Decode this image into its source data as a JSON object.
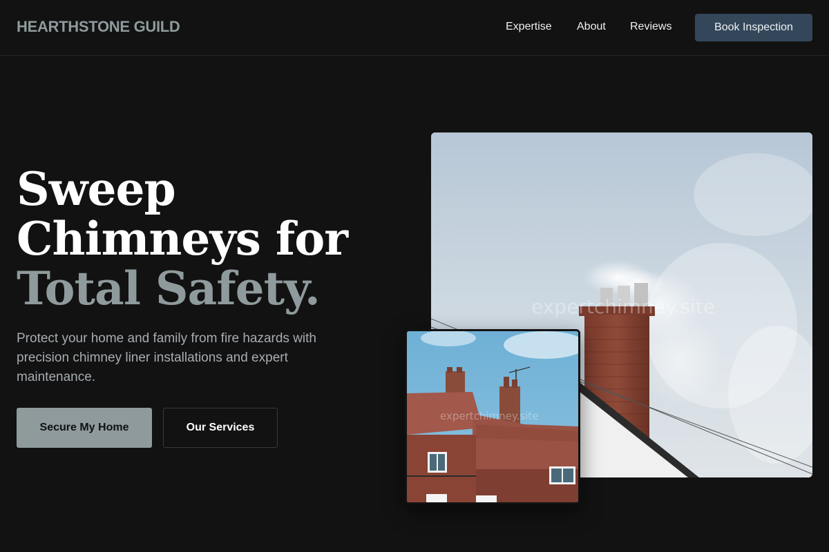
{
  "brand": {
    "name": "HEARTHSTONE GUILD"
  },
  "nav": {
    "links": [
      "Expertise",
      "About",
      "Reviews"
    ],
    "cta": "Book Inspection"
  },
  "hero": {
    "title_lines": [
      "Sweep",
      "Chimneys for"
    ],
    "title_accent": "Total Safety.",
    "description": "Protect your home and family from fire hazards with precision chimney liner installations and expert maintenance.",
    "primary_button": "Secure My Home",
    "secondary_button": "Our Services"
  },
  "images": {
    "main_watermark": "expertchimney.site",
    "inset_watermark": "expertchimney.site"
  },
  "colors": {
    "background": "#121212",
    "accent": "#8f9a9c",
    "nav_button": "#34475a",
    "text_primary": "#ffffff",
    "text_muted": "#a7adb2"
  }
}
